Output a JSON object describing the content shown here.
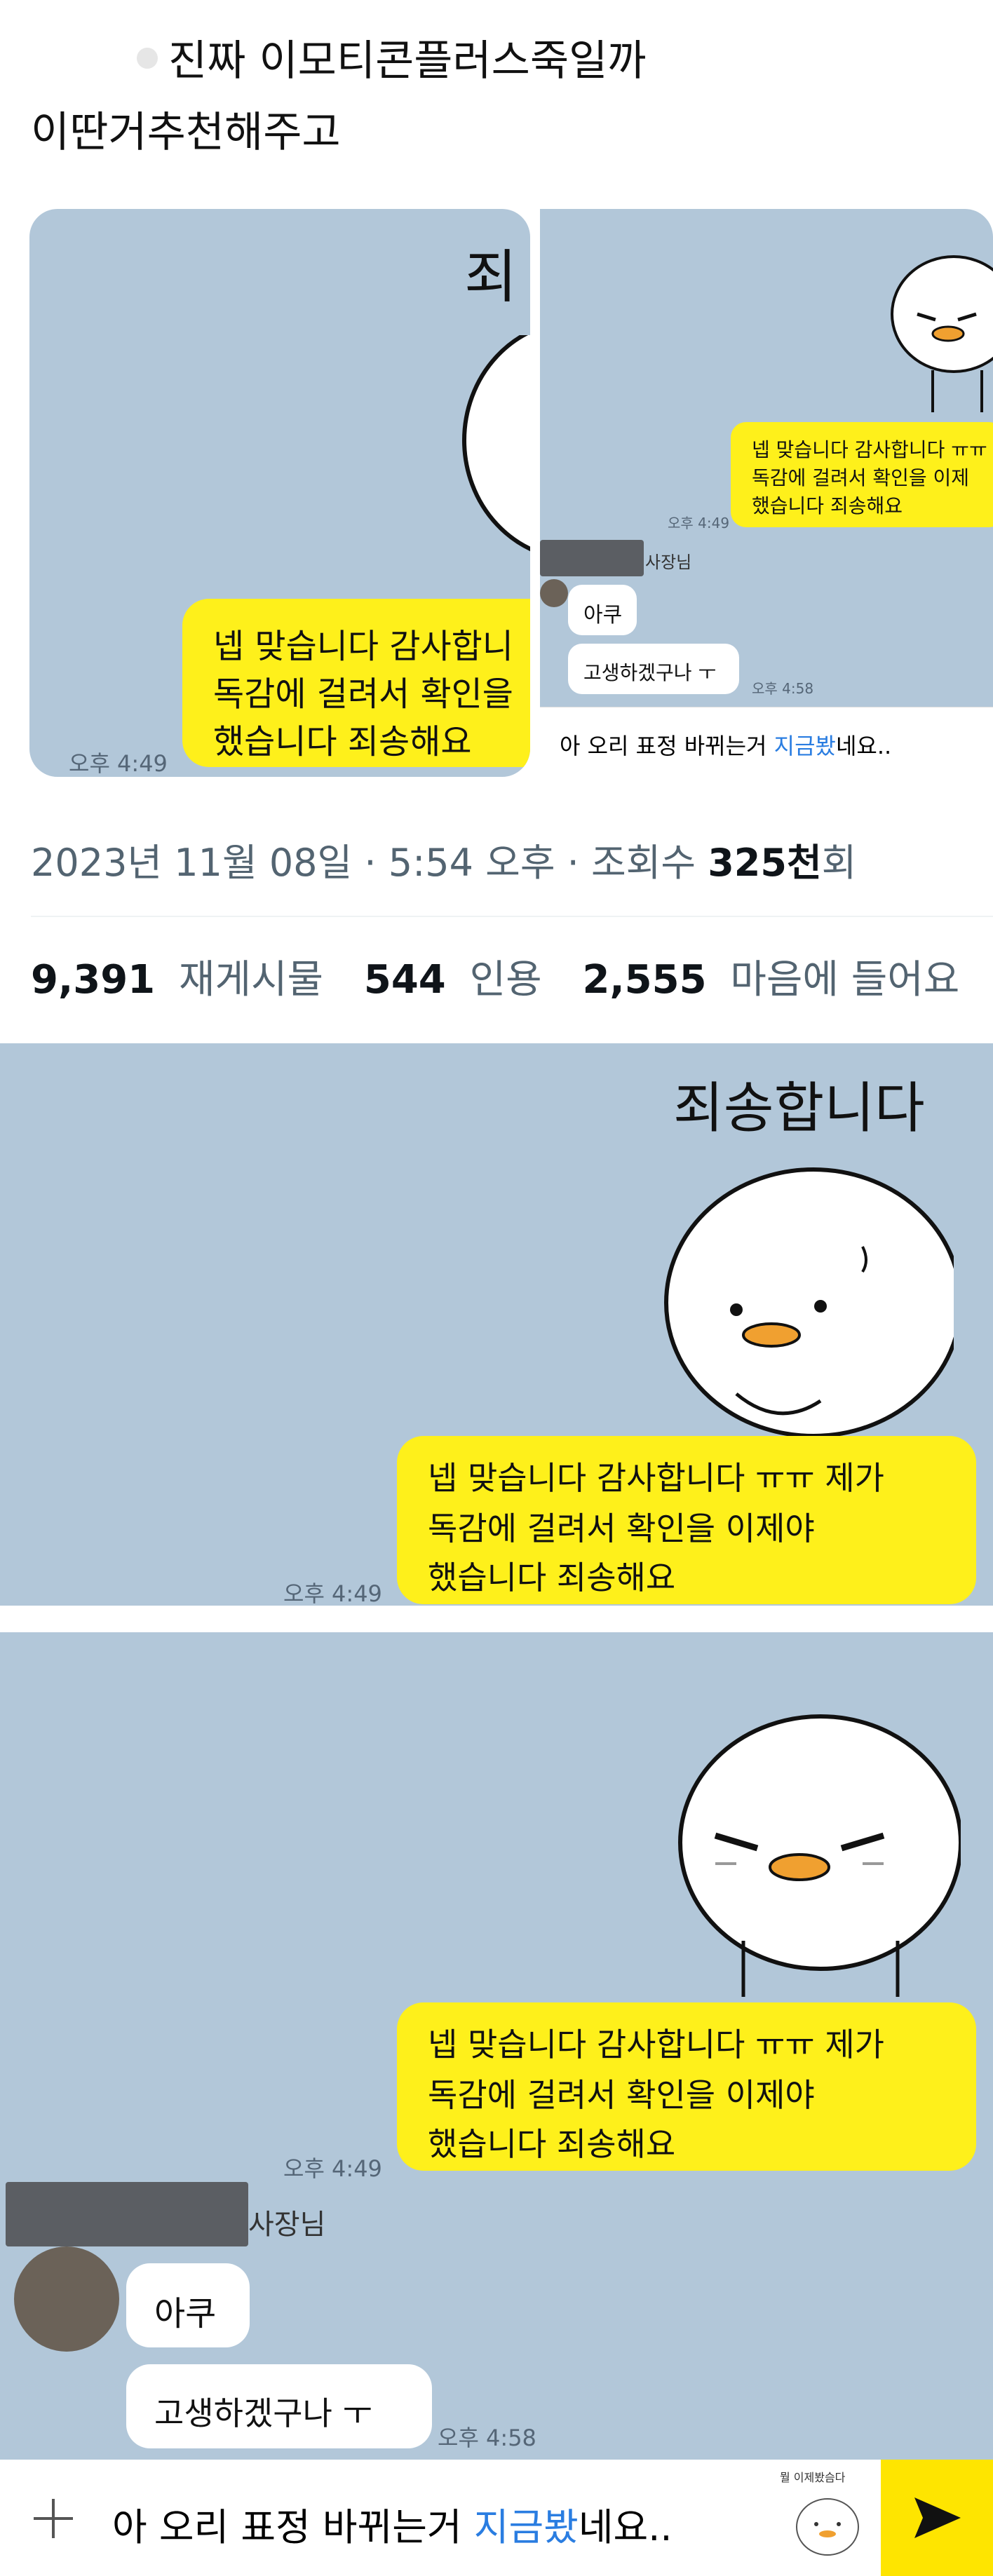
{
  "tweet": {
    "text_line1": "진짜 이모티콘플러스죽일까",
    "text_line2": "이딴거추천해주고",
    "meta_date": "2023년 11월 08일 · 5:54 오후 · 조회수",
    "meta_views_num": "325천",
    "meta_views_unit": "회",
    "stats": {
      "reposts_num": "9,391",
      "reposts_label": "재게시물",
      "quotes_num": "544",
      "quotes_label": "인용",
      "likes_num": "2,555",
      "likes_label": "마음에 들어요"
    }
  },
  "thumb_left": {
    "sticker_text": "죄",
    "bubble_l1": "넵 맞습니다 감사합니",
    "bubble_l2": "독감에 걸려서 확인을",
    "bubble_l3": "했습니다 죄송해요",
    "time": "오후 4:49"
  },
  "thumb_right": {
    "bubble_l1": "넵 맞습니다 감사합니다 ㅠㅠ",
    "bubble_l2": "독감에 걸려서 확인을 이제",
    "bubble_l3": "했습니다 죄송해요",
    "time1": "오후 4:49",
    "sender": "사장님",
    "msg1": "아쿠",
    "msg2": "고생하겠구나 ㅜ",
    "time2": "오후 4:58",
    "input_pre": "아 오리 표정 바뀌는거 ",
    "input_hl": "지금봤",
    "input_post": "네요.."
  },
  "shot1": {
    "sticker_text": "죄송합니다",
    "bubble_l1": "넵 맞습니다 감사합니다 ㅠㅠ 제가",
    "bubble_l2": "독감에 걸려서 확인을 이제야",
    "bubble_l3": "했습니다 죄송해요",
    "time": "오후 4:49"
  },
  "shot2": {
    "bubble_l1": "넵 맞습니다 감사합니다 ㅠㅠ 제가",
    "bubble_l2": "독감에 걸려서 확인을 이제야",
    "bubble_l3": "했습니다 죄송해요",
    "time1": "오후 4:49",
    "sender": "사장님",
    "msg1": "아쿠",
    "msg2": "고생하겠구나 ㅜ",
    "time2": "오후 4:58",
    "input_pre": "아 오리 표정 바뀌는거 ",
    "input_hl": "지금봤",
    "input_post": "네요..",
    "sticker_preview_text": "뭘 이제봤슴다"
  },
  "colors": {
    "chat_bg": "#b2c7d9",
    "bubble_yellow": "#fef01b",
    "send_yellow": "#fee500",
    "highlight_blue": "#2a7de1"
  }
}
